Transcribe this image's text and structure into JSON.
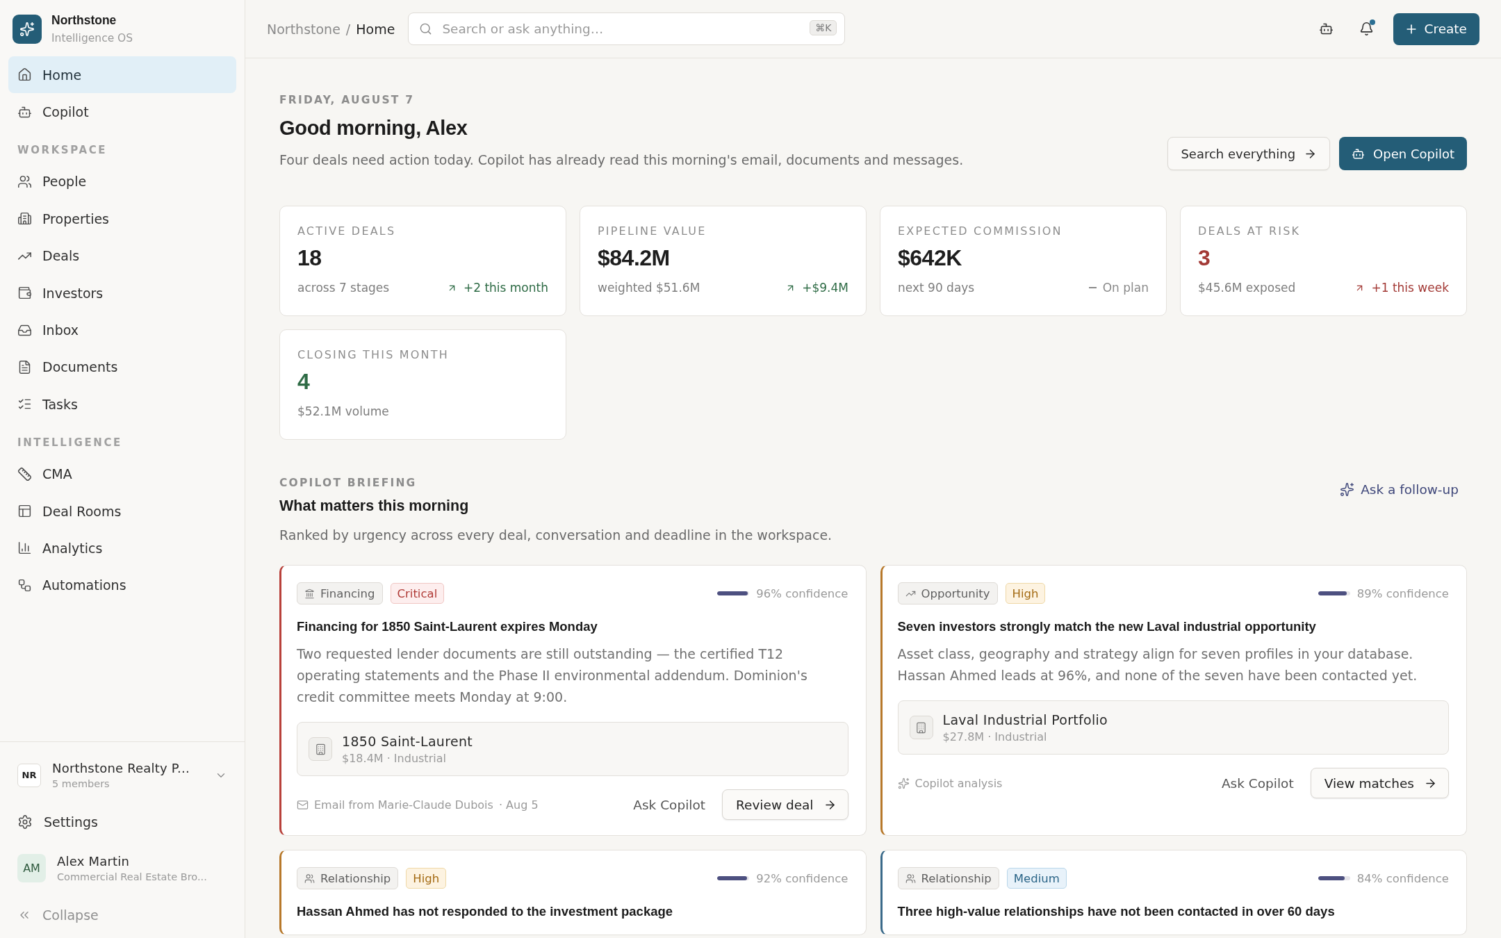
{
  "sidebar": {
    "brand": {
      "name": "Northstone",
      "subtitle": "Intelligence OS"
    },
    "items": [
      {
        "label": "Home",
        "selected": true
      },
      {
        "label": "Copilot",
        "selected": false
      }
    ],
    "sections": [
      {
        "title": "WORKSPACE",
        "items": [
          {
            "label": "People",
            "selected": false
          },
          {
            "label": "Properties",
            "selected": false
          },
          {
            "label": "Deals",
            "selected": false
          },
          {
            "label": "Investors",
            "selected": false
          },
          {
            "label": "Inbox",
            "selected": false
          },
          {
            "label": "Documents",
            "selected": false
          },
          {
            "label": "Tasks",
            "selected": false
          }
        ]
      },
      {
        "title": "INTELLIGENCE",
        "items": [
          {
            "label": "CMA",
            "selected": false
          },
          {
            "label": "Deal Rooms",
            "selected": false
          },
          {
            "label": "Analytics",
            "selected": false
          },
          {
            "label": "Automations",
            "selected": false
          }
        ]
      }
    ],
    "workspace": {
      "initials": "NR",
      "name": "Northstone Realty P...",
      "members": "5 members"
    },
    "settings": "Settings",
    "user": {
      "initials": "AM",
      "name": "Alex Martin",
      "role": "Commercial Real Estate Bro..."
    },
    "collapse": "Collapse"
  },
  "topbar": {
    "breadcrumb": {
      "parent": "Northstone",
      "separator": "/",
      "current": "Home"
    },
    "search": {
      "placeholder": "Search or ask anything…",
      "shortcut": "⌘K"
    },
    "notifications": {
      "unread": true
    },
    "create": "Create"
  },
  "header": {
    "date": "FRIDAY, AUGUST 7",
    "title": "Good morning, Alex",
    "subtitle": "Four deals need action today. Copilot has already read this morning's email, documents and messages.",
    "buttons": [
      {
        "label": "Search everything",
        "kind": "secondary"
      },
      {
        "label": "Open Copilot",
        "kind": "primary"
      }
    ]
  },
  "stats": [
    {
      "label": "ACTIVE DEALS",
      "value": "18",
      "kind": "plain",
      "note": "across 7 stages",
      "trend": {
        "text": "+2 this month",
        "kind": "gain"
      }
    },
    {
      "label": "PIPELINE VALUE",
      "value": "$84.2M",
      "kind": "plain",
      "note": "weighted $51.6M",
      "trend": {
        "text": "+$9.4M",
        "kind": "gain"
      }
    },
    {
      "label": "EXPECTED COMMISSION",
      "value": "$642K",
      "kind": "plain",
      "note": "next 90 days",
      "trend": {
        "text": "On plan",
        "kind": "steady"
      }
    },
    {
      "label": "DEALS AT RISK",
      "value": "3",
      "kind": "alert",
      "note": "$45.6M exposed",
      "trend": {
        "text": "+1 this week",
        "kind": "alert"
      }
    },
    {
      "label": "CLOSING THIS MONTH",
      "value": "4",
      "kind": "good",
      "note": "$52.1M volume"
    }
  ],
  "briefing": {
    "eyebrow": "COPILOT BRIEFING",
    "title": "What matters this morning",
    "subtitle": "Ranked by urgency across every deal, conversation and deadline in the workspace.",
    "follow_up": "Ask a follow-up",
    "cards": [
      {
        "category": {
          "label": "Financing",
          "kind": "financing"
        },
        "priority": {
          "label": "Critical",
          "kind": "critical"
        },
        "level": 0.96,
        "confidence": "96% confidence",
        "title": "Financing for 1850 Saint-Laurent expires Monday",
        "body": "Two requested lender documents are still outstanding — the certified T12 operating statements and the Phase II environmental addendum. Dominion's credit committee meets Monday at 9:00.",
        "property": {
          "name": "1850 Saint-Laurent",
          "meta": "$18.4M · Industrial"
        },
        "source": {
          "kind": "email",
          "text": "Email from Marie-Claude Dubois",
          "date": "· Aug 5"
        },
        "actions": [
          {
            "label": "Ask Copilot",
            "kind": "ghost"
          },
          {
            "label": "Review deal",
            "kind": "outline"
          }
        ]
      },
      {
        "category": {
          "label": "Opportunity",
          "kind": "opportunity"
        },
        "priority": {
          "label": "High",
          "kind": "high"
        },
        "level": 0.89,
        "confidence": "89% confidence",
        "title": "Seven investors strongly match the new Laval industrial opportunity",
        "body": "Asset class, geography and strategy align for seven profiles in your database. Hassan Ahmed leads at 96%, and none of the seven have been contacted yet.",
        "property": {
          "name": "Laval Industrial Portfolio",
          "meta": "$27.8M · Industrial"
        },
        "source": {
          "kind": "analysis",
          "text": "Copilot analysis"
        },
        "actions": [
          {
            "label": "Ask Copilot",
            "kind": "ghost"
          },
          {
            "label": "View matches",
            "kind": "outline"
          }
        ]
      },
      {
        "category": {
          "label": "Relationship",
          "kind": "relationship"
        },
        "priority": {
          "label": "High",
          "kind": "high"
        },
        "level": 0.92,
        "confidence": "92% confidence",
        "title": "Hassan Ahmed has not responded to the investment package"
      },
      {
        "category": {
          "label": "Relationship",
          "kind": "relationship"
        },
        "priority": {
          "label": "Medium",
          "kind": "medium"
        },
        "level": 0.84,
        "confidence": "84% confidence",
        "title": "Three high-value relationships have not been contacted in over 60 days"
      }
    ]
  }
}
